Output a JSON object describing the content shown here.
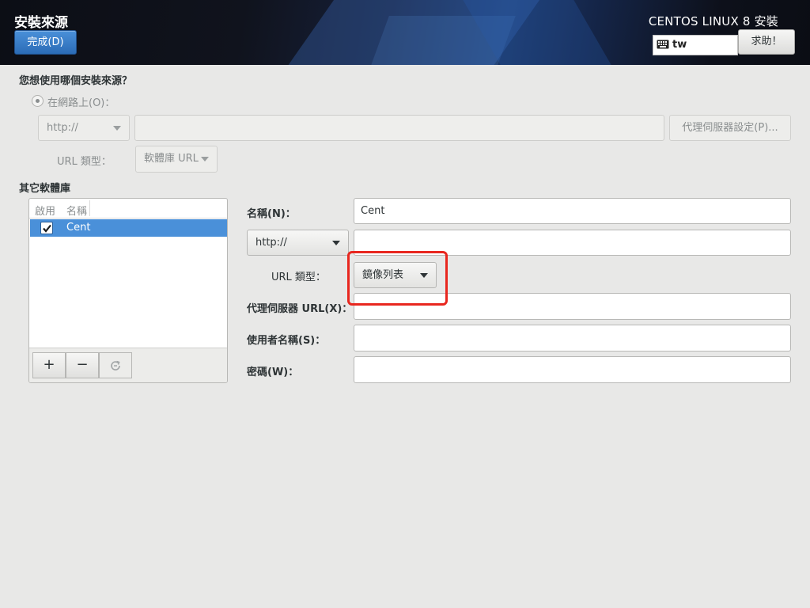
{
  "header": {
    "spoke_title": "安裝來源",
    "done_label": "完成(D)",
    "product_title": "CENTOS LINUX 8 安裝",
    "keyboard_layout": "tw",
    "help_label": "求助！"
  },
  "main_source": {
    "question": "您想使用哪個安裝來源？",
    "network_radio_label": "在網路上(O)：",
    "protocol_value": "http://",
    "url_value": "",
    "proxy_button_label": "代理伺服器設定(P)...",
    "url_type_label": "URL 類型：",
    "url_type_value": "軟體庫 URL"
  },
  "additional_repos": {
    "heading": "其它軟體庫",
    "columns": [
      "啟用",
      "名稱"
    ],
    "rows": [
      {
        "enabled": true,
        "name": "Cent",
        "selected": true
      }
    ],
    "toolbar": {
      "add": "+",
      "remove": "−",
      "refresh_icon": "refresh-icon"
    }
  },
  "repo_detail": {
    "name_label": "名稱(N)：",
    "name_value": "Cent",
    "protocol_value": "http://",
    "url_value": "",
    "url_type_label": "URL 類型：",
    "url_type_value": "鏡像列表",
    "proxy_url_label": "代理伺服器 URL(X)：",
    "proxy_url_value": "",
    "username_label": "使用者名稱(S)：",
    "username_value": "",
    "password_label": "密碼(W)：",
    "password_value": ""
  },
  "colors": {
    "selection": "#4a90d9",
    "highlight": "#e8271f",
    "background": "#e8e8e7"
  }
}
